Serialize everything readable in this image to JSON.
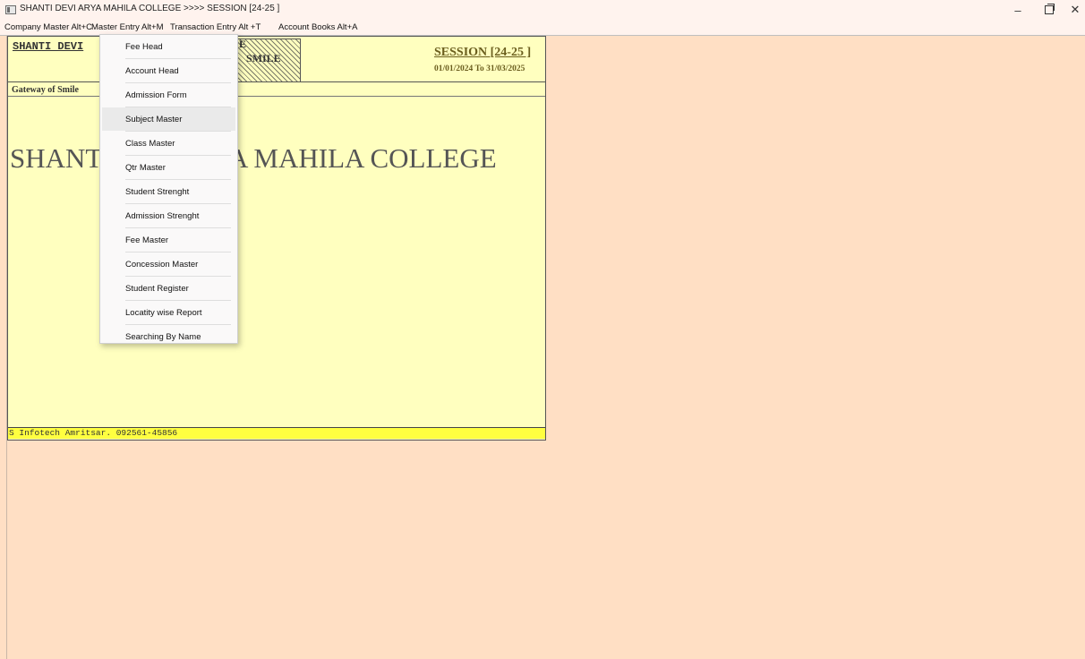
{
  "window": {
    "title": "SHANTI DEVI ARYA MAHILA COLLEGE   >>>> SESSION [24-25 ]",
    "minimize": "–",
    "close": "✕"
  },
  "menubar": {
    "items": [
      "Company Master Alt+C",
      "Master Entry Alt+M",
      "Transaction Entry Alt +T",
      "Account Books Alt+A"
    ]
  },
  "header": {
    "college_short": "SHANTI DEVI",
    "logo_top": "E",
    "logo_text": "SMILE",
    "session_title": "SESSION [24-25 ]",
    "session_dates": "01/01/2024 To 31/03/2025",
    "tagline": "Gateway of Smile"
  },
  "main": {
    "big_title_left": "SHANTI",
    "big_title_right": "A MAHILA COLLEGE"
  },
  "footer": {
    "text": "S Infotech Amritsar. 092561-45856"
  },
  "dropdown": {
    "items": [
      "Fee Head",
      "Account Head",
      "Admission Form",
      "Subject Master",
      "Class Master",
      "Qtr Master",
      "Student Strenght",
      "Admission Strenght",
      "Fee Master",
      "Concession Master",
      "Student Register",
      "Locatity wise Report",
      "Searching By Name"
    ],
    "highlighted": "Subject Master"
  }
}
